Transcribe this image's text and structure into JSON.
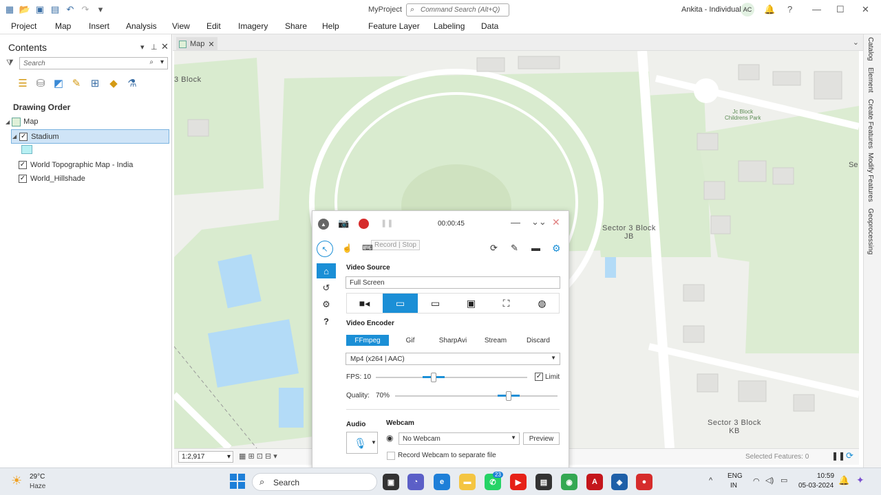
{
  "titlebar": {
    "project": "MyProject",
    "search_placeholder": "Command Search (Alt+Q)",
    "user": "Ankita - Individual",
    "avatar": "AC"
  },
  "ribbon": {
    "tabs": [
      "Project",
      "Map",
      "Insert",
      "Analysis",
      "View",
      "Edit",
      "Imagery",
      "Share",
      "Help"
    ],
    "context_tabs": [
      "Feature Layer",
      "Labeling",
      "Data"
    ]
  },
  "contents": {
    "title": "Contents",
    "search_placeholder": "Search",
    "drawing_order": "Drawing Order",
    "map_label": "Map",
    "layers": [
      {
        "label": "Stadium",
        "checked": true,
        "selected": true
      },
      {
        "label": "World Topographic Map - India",
        "checked": true
      },
      {
        "label": "World_Hillshade",
        "checked": true
      }
    ]
  },
  "map": {
    "tab_label": "Map",
    "labels": [
      "3 Block",
      "Sector 3 Block\nJB",
      "Jc Block\nChildrens Park",
      "Se",
      "Sector 3 Block\nKB"
    ],
    "scale": "1:2,917",
    "selected_features": "Selected Features: 0"
  },
  "right_dock": [
    "Catalog",
    "Element",
    "Create Features",
    "Modify Features",
    "Geoprocessing"
  ],
  "recorder": {
    "time": "00:00:45",
    "tooltip": "Record | Stop",
    "video_source_label": "Video Source",
    "video_source_value": "Full Screen",
    "video_encoder_label": "Video Encoder",
    "encoder_tabs": [
      "FFmpeg",
      "Gif",
      "SharpAvi",
      "Stream",
      "Discard"
    ],
    "encoder_active": "FFmpeg",
    "format_value": "Mp4 (x264 | AAC)",
    "fps_label": "FPS:",
    "fps_value": "10",
    "fps_fraction": 0.38,
    "limit_label": "Limit",
    "limit_checked": true,
    "quality_label": "Quality:",
    "quality_value": "70%",
    "quality_fraction": 0.7,
    "audio_label": "Audio",
    "webcam_label": "Webcam",
    "webcam_value": "No Webcam",
    "preview_label": "Preview",
    "record_webcam_label": "Record Webcam to separate file"
  },
  "taskbar": {
    "weather_temp": "29°C",
    "weather_desc": "Haze",
    "search_label": "Search",
    "badge": "23",
    "lang_top": "ENG",
    "lang_bottom": "IN",
    "time": "10:59",
    "date": "05-03-2024"
  },
  "colors": {
    "accent": "#1b8fd6",
    "record_red": "#d62c2c",
    "stadium_fill": "#b8f0f3",
    "water": "#b3dbf7",
    "park": "#d9ebcf"
  }
}
